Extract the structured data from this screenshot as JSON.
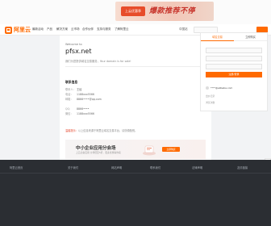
{
  "banner": {
    "chip_label": "上云优惠季",
    "slogan": "爆款推荐不停"
  },
  "nav": {
    "logo_text": "阿里云",
    "items": [
      "最新活动",
      "产品",
      "解决方案",
      "云市场",
      "合作伙伴",
      "支持与服务",
      "了解阿里云"
    ],
    "right_items": [
      "中国站"
    ]
  },
  "main": {
    "welcome": "Welcome to",
    "domain": "pfsx.net",
    "intro": "我们为您提供域名交易服务，Your domain is for sale!",
    "contact_heading": "联系信息",
    "rows": [
      {
        "k": "联系人：",
        "v": "王经"
      },
      {
        "k": "电话：",
        "v": "1188xxx5566"
      },
      {
        "k": "邮箱：",
        "v": "8866••••@qq.com"
      },
      {
        "k": "QQ：",
        "v": "8866••••"
      },
      {
        "k": "微信：",
        "v": "1188xxx5566"
      }
    ],
    "note_highlight": "温馨提示：",
    "note_text": "以上信息来源于阿里云域名交易平台，请谨慎甄别。",
    "promo": {
      "title": "中小企业应用分会场",
      "subtitle": "上云必备应用 全场低至5折，更多优惠等你来",
      "button": "立即购买"
    }
  },
  "panel": {
    "tabs": [
      "域名交易",
      "立即购买"
    ],
    "button": "注册/登录",
    "user": "****@alibaba.com",
    "meta": [
      "出价记录",
      "浏览次数"
    ]
  },
  "footer": {
    "items": [
      "阿里云首页",
      "关于我们",
      "网站声明",
      "联系我们",
      "法律声明",
      "友情链接"
    ]
  }
}
